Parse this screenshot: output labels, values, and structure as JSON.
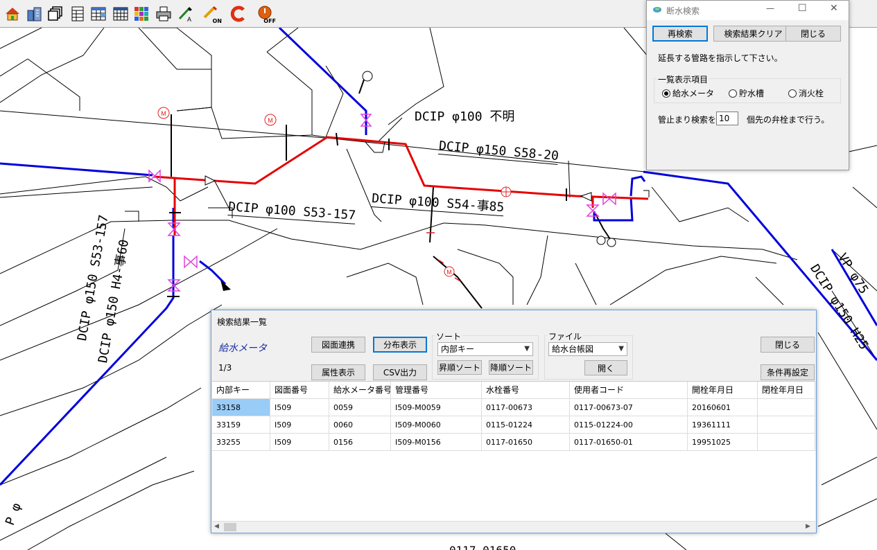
{
  "toolbar": {
    "icons": [
      "home-icon",
      "buildings-icon",
      "layers-icon",
      "table-icon",
      "table-grid-icon",
      "spreadsheet-icon",
      "colorful-grid-icon",
      "printer-icon",
      "pen-a-icon",
      "on-tool-icon",
      "refresh-c-icon",
      "off-power-icon"
    ],
    "on_label": "ON",
    "off_label": "OFF"
  },
  "map_labels": {
    "l1": "DCIP φ100 不明",
    "l2": "DCIP φ150 S58-20",
    "l3": "DCIP φ100 S53-157",
    "l4": "DCIP φ100 S54-事85",
    "l5": "DCIP φ150 S53-157",
    "l6": "DCIP φ150 H4-事60",
    "l7": "DCIP φ150 H25",
    "l8": "VP φ75",
    "l9": "P φ",
    "l10": "0117-01650"
  },
  "colors": {
    "red_pipe": "#e60000",
    "blue_pipe": "#0000dc",
    "valve": "#e040e0",
    "meter": "#e02020"
  },
  "search_dialog": {
    "title": "断水検索",
    "minimize": "—",
    "maximize": "☐",
    "close": "✕",
    "btn_research": "再検索",
    "btn_clear": "検索結果クリア",
    "btn_close": "閉じる",
    "instruction": "延長する管路を指示して下さい。",
    "group_title": "一覧表示項目",
    "radios": [
      {
        "label": "給水メータ",
        "checked": true
      },
      {
        "label": "貯水槽",
        "checked": false
      },
      {
        "label": "消火栓",
        "checked": false
      }
    ],
    "stop_prefix": "管止まり検索を",
    "stop_value": "10",
    "stop_suffix": "個先の弁栓まで行う。"
  },
  "results": {
    "title": "検索結果一覧",
    "type_label": "給水メータ",
    "page": "1/3",
    "btn_link": "図面連携",
    "btn_dist": "分布表示",
    "btn_attr": "属性表示",
    "btn_csv": "CSV出力",
    "sort_title": "ソート",
    "sort_value": "内部キー",
    "btn_asc": "昇順ソート",
    "btn_desc": "降順ソート",
    "file_title": "ファイル",
    "file_value": "給水台帳図",
    "btn_open": "開く",
    "btn_close": "閉じる",
    "btn_reset": "条件再設定",
    "columns": [
      "内部キー",
      "図面番号",
      "給水メータ番号",
      "管理番号",
      "水栓番号",
      "使用者コード",
      "開栓年月日",
      "閉栓年月日"
    ],
    "rows": [
      [
        "33158",
        "I509",
        "0059",
        "I509-M0059",
        "0117-00673",
        "0117-00673-07",
        "20160601",
        ""
      ],
      [
        "33159",
        "I509",
        "0060",
        "I509-M0060",
        "0115-01224",
        "0115-01224-00",
        "19361111",
        ""
      ],
      [
        "33255",
        "I509",
        "0156",
        "I509-M0156",
        "0117-01650",
        "0117-01650-01",
        "19951025",
        ""
      ]
    ],
    "scroll_left": "◀",
    "scroll_right": "▶"
  }
}
